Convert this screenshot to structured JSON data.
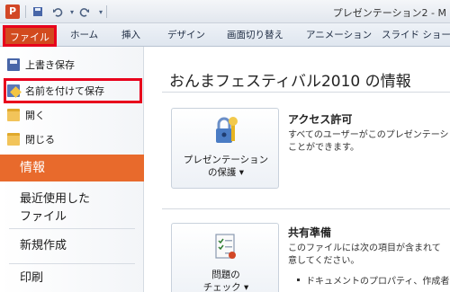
{
  "titlebar": {
    "app_icon": "P",
    "title": "プレゼンテーション2 - M"
  },
  "tabs": {
    "file": "ファイル",
    "items": [
      "ホーム",
      "挿入",
      "デザイン",
      "画面切り替え",
      "アニメーション",
      "スライド ショー"
    ]
  },
  "backstage": {
    "save": "上書き保存",
    "save_as": "名前を付けて保存",
    "open": "開く",
    "close": "閉じる",
    "info": "情報",
    "recent_line1": "最近使用した",
    "recent_line2": "ファイル",
    "new": "新規作成",
    "print": "印刷"
  },
  "main": {
    "title": "おんまフェスティバル2010 の情報",
    "permissions": {
      "button_line1": "プレゼンテーション",
      "button_line2": "の保護 ▾",
      "title": "アクセス許可",
      "desc_line1": "すべてのユーザーがこのプレゼンテーシ",
      "desc_line2": "ことができます。"
    },
    "prepare": {
      "button_line1": "問題の",
      "button_line2": "チェック ▾",
      "title": "共有準備",
      "desc_line1": "このファイルには次の項目が含まれて",
      "desc_line2": "意してください。",
      "bullet1": "ドキュメントのプロパティ、作成者"
    }
  },
  "colors": {
    "file_tab": "#d24a1e",
    "info_highlight": "#e86a2c",
    "callout_red": "#e8001c"
  }
}
